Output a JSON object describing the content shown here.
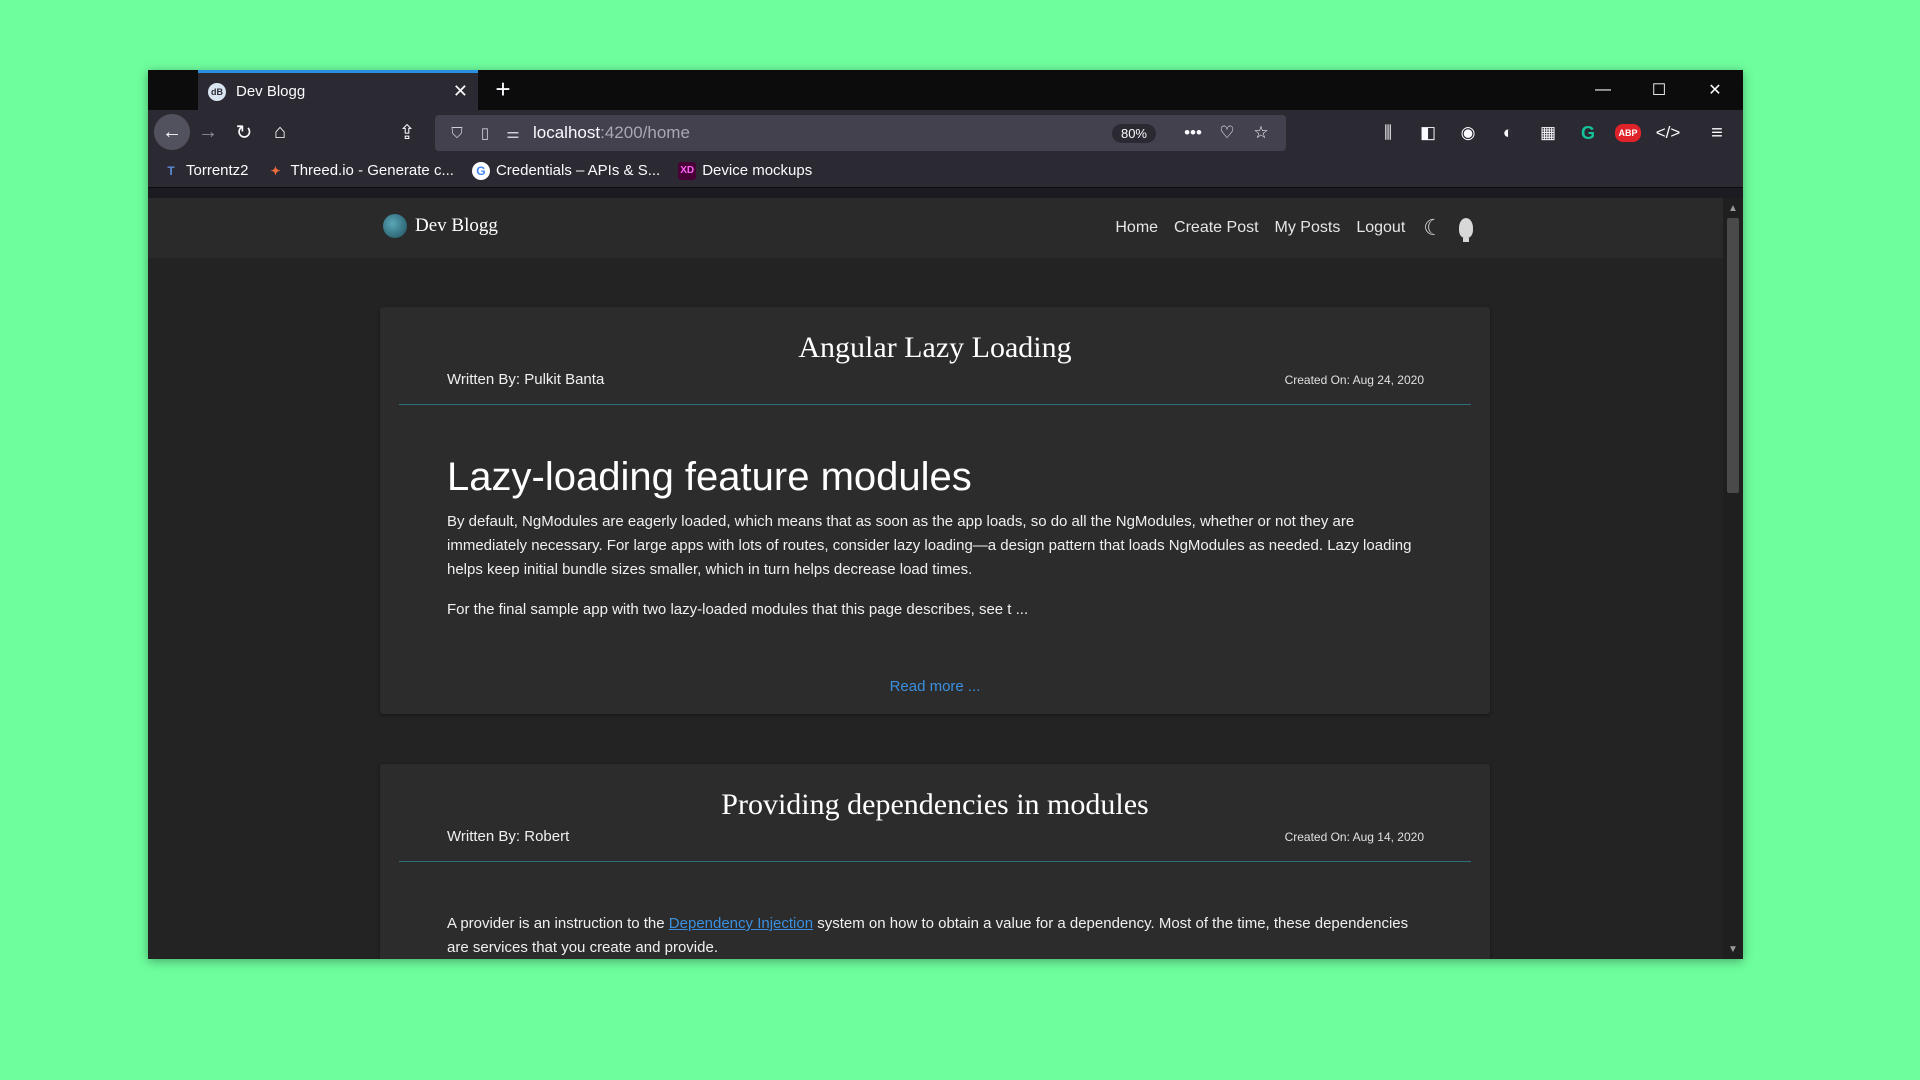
{
  "browser": {
    "tab_title": "Dev Blogg",
    "tab_favicon": "dB",
    "url_host": "localhost",
    "url_path": ":4200/home",
    "zoom": "80%",
    "bookmarks": [
      {
        "label": "Torrentz2",
        "icon": "T",
        "color": "#5a8bd6"
      },
      {
        "label": "Threed.io - Generate c...",
        "icon": "✦",
        "color": "#f06a3a"
      },
      {
        "label": "Credentials – APIs & S...",
        "icon": "G",
        "color": "#ffffff"
      },
      {
        "label": "Device mockups",
        "icon": "XD",
        "color": "#ff2bc2"
      }
    ]
  },
  "site": {
    "brand": "Dev Blogg",
    "nav": [
      "Home",
      "Create Post",
      "My Posts",
      "Logout"
    ]
  },
  "posts": [
    {
      "title": "Angular Lazy Loading",
      "author": "Written By: Pulkit Banta",
      "created": "Created On: Aug 24, 2020",
      "heading": "Lazy-loading feature modules",
      "para1": "By default, NgModules are eagerly loaded, which means that as soon as the app loads, so do all the NgModules, whether or not they are immediately necessary. For large apps with lots of routes, consider lazy loading—a design pattern that loads NgModules as needed. Lazy loading helps keep initial bundle sizes smaller, which in turn helps decrease load times.",
      "para2": "For the final sample app with two lazy-loaded modules that this page describes, see t ...",
      "read_more": "Read more ..."
    },
    {
      "title": "Providing dependencies in modules",
      "author": "Written By: Robert",
      "created": "Created On: Aug 14, 2020",
      "para1_a": "A provider is an instruction to the ",
      "para1_link": "Dependency Injection",
      "para1_b": " system on how to obtain a value for a dependency. Most of the time, these dependencies are services that you create and provide."
    }
  ],
  "colors": {
    "accent_tab": "#2b8fe0",
    "link": "#3a8fe0",
    "page_bg": "#232323",
    "card_bg": "#2c2c2c",
    "divider": "#2f6f7a"
  }
}
